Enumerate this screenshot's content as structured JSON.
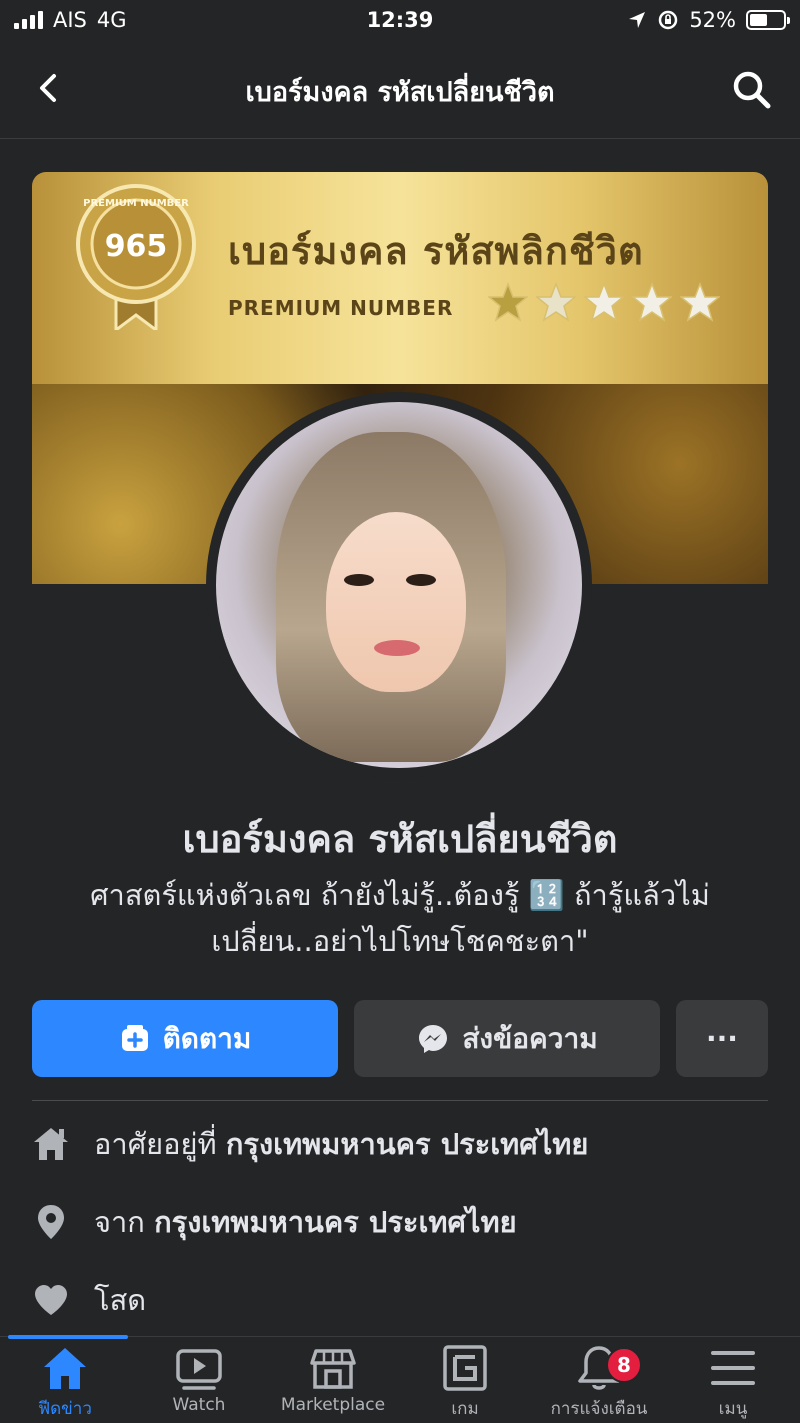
{
  "status_bar": {
    "carrier": "AIS",
    "network": "4G",
    "time": "12:39",
    "battery": "52%",
    "battery_level": 0.52
  },
  "nav": {
    "title": "เบอร์มงคล รหัสเปลี่ยนชีวิต",
    "back_icon": "chevron-left-icon",
    "search_icon": "search-icon"
  },
  "cover": {
    "badge_top": "PREMIUM NUMBER",
    "badge_number": "965",
    "headline": "เบอร์มงคล รหัสพลิกชีวิต",
    "subline": "PREMIUM NUMBER",
    "star_count": 5
  },
  "profile": {
    "name": "เบอร์มงคล รหัสเปลี่ยนชีวิต",
    "bio_line1": "ศาสตร์แห่งตัวเลข ถ้ายังไม่รู้..ต้องรู้ 🔢 ถ้ารู้แล้วไม่",
    "bio_line2": "เปลี่ยน..อย่าไปโทษโชคชะตา\""
  },
  "actions": {
    "follow": "ติดตาม",
    "message": "ส่งข้อความ",
    "more": "···"
  },
  "details": [
    {
      "icon": "home-icon",
      "prefix": "อาศัยอยู่ที่",
      "value": "กรุงเทพมหานคร ประเทศไทย"
    },
    {
      "icon": "location-pin-icon",
      "prefix": "จาก",
      "value": "กรุงเทพมหานคร ประเทศไทย"
    },
    {
      "icon": "heart-icon",
      "prefix": "โสด",
      "value": ""
    }
  ],
  "tabs": [
    {
      "label": "ฟีดข่าว",
      "icon": "home-icon",
      "active": true
    },
    {
      "label": "Watch",
      "icon": "watch-icon"
    },
    {
      "label": "Marketplace",
      "icon": "marketplace-icon"
    },
    {
      "label": "เกม",
      "icon": "gaming-icon"
    },
    {
      "label": "การแจ้งเตือน",
      "icon": "bell-icon",
      "badge": "8"
    },
    {
      "label": "เมนู",
      "icon": "menu-icon"
    }
  ],
  "colors": {
    "accent": "#2d88ff",
    "background": "#242526",
    "button_secondary": "#3a3b3c",
    "notification_badge": "#e41e3f"
  }
}
